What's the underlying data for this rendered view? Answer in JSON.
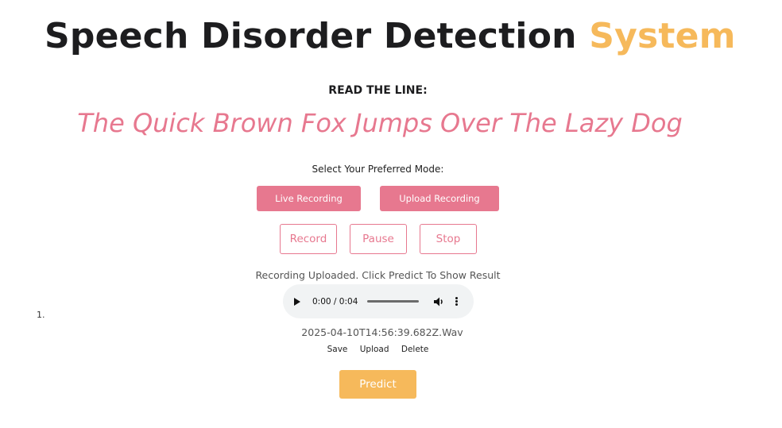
{
  "header": {
    "title_main": "Speech Disorder Detection",
    "title_accent": "System"
  },
  "prompt": {
    "label": "READ THE LINE:",
    "sentence": "The Quick Brown Fox Jumps Over The Lazy Dog"
  },
  "mode": {
    "label": "Select Your Preferred Mode:",
    "live_label": "Live Recording",
    "upload_label": "Upload Recording"
  },
  "controls": {
    "record_label": "Record",
    "pause_label": "Pause",
    "stop_label": "Stop"
  },
  "status_text": "Recording Uploaded. Click Predict To Show Result",
  "list_marker": "1.",
  "audio": {
    "time": "0:00 / 0:04",
    "play_icon": "play-icon",
    "volume_icon": "volume-icon",
    "menu_icon": "more-vert-icon"
  },
  "file": {
    "name": "2025-04-10T14:56:39.682Z.Wav",
    "save_label": "Save",
    "upload_label": "Upload",
    "delete_label": "Delete"
  },
  "predict_label": "Predict",
  "colors": {
    "accent_orange": "#f6b95b",
    "accent_pink": "#e7788f",
    "text_dark": "#1d1d1f"
  }
}
